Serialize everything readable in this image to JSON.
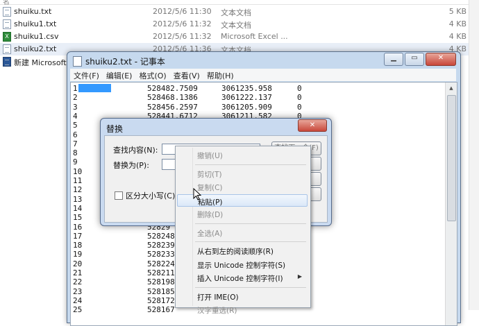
{
  "explorer": {
    "header_fragment": "名",
    "files": [
      {
        "name": "shuiku.txt",
        "date": "2012/5/6 11:30",
        "type": "文本文档",
        "size": "5 KB",
        "icon": "text-file-icon"
      },
      {
        "name": "shuiku1.txt",
        "date": "2012/5/6 11:32",
        "type": "文本文档",
        "size": "4 KB",
        "icon": "text-file-icon"
      },
      {
        "name": "shuiku1.csv",
        "date": "2012/5/6 11:32",
        "type": "Microsoft Excel ...",
        "size": "4 KB",
        "icon": "excel-file-icon"
      },
      {
        "name": "shuiku2.txt",
        "date": "2012/5/6 11:36",
        "type": "文本文档",
        "size": "4 KB",
        "icon": "text-file-icon",
        "selected": true
      },
      {
        "name": "新建 Microsoft Word",
        "date": "",
        "type": "",
        "size": "",
        "icon": "word-file-icon"
      }
    ]
  },
  "notepad": {
    "title": "shuiku2.txt - 记事本",
    "menu": [
      "文件(F)",
      "编辑(E)",
      "格式(O)",
      "查看(V)",
      "帮助(H)"
    ],
    "lines": [
      {
        "n": "1",
        "a": "528482.7509",
        "b": "3061235.958",
        "c": "0"
      },
      {
        "n": "2",
        "a": "528468.1386",
        "b": "3061222.137",
        "c": "0"
      },
      {
        "n": "3",
        "a": "528456.2597",
        "b": "3061205.909",
        "c": "0"
      },
      {
        "n": "4",
        "a": "528441.6712",
        "b": "3061211.582",
        "c": "0"
      },
      {
        "n": "5",
        "a": "",
        "b": "",
        "c": ""
      },
      {
        "n": "6",
        "a": "",
        "b": "",
        "c": ""
      },
      {
        "n": "7",
        "a": "",
        "b": "",
        "c": ""
      },
      {
        "n": "8",
        "a": "",
        "b": "",
        "c": ""
      },
      {
        "n": "9",
        "a": "",
        "b": "",
        "c": ""
      },
      {
        "n": "10",
        "a": "",
        "b": "",
        "c": ""
      },
      {
        "n": "11",
        "a": "",
        "b": "",
        "c": ""
      },
      {
        "n": "12",
        "a": "",
        "b": "",
        "c": ""
      },
      {
        "n": "13",
        "a": "",
        "b": "",
        "c": ""
      },
      {
        "n": "14",
        "a": "",
        "b": "",
        "c": ""
      },
      {
        "n": "15",
        "a": "",
        "b": "",
        "c": ""
      },
      {
        "n": "16",
        "a": "52829",
        "b": "",
        "c": ""
      },
      {
        "n": "17",
        "a": "528248.",
        "b": "",
        "c": ""
      },
      {
        "n": "18",
        "a": "528239.",
        "b": "",
        "c": ""
      },
      {
        "n": "19",
        "a": "528233.",
        "b": "",
        "c": ""
      },
      {
        "n": "20",
        "a": "528224.",
        "b": "",
        "c": ""
      },
      {
        "n": "21",
        "a": "528211.",
        "b": "",
        "c": ""
      },
      {
        "n": "22",
        "a": "528198.",
        "b": "",
        "c": ""
      },
      {
        "n": "23",
        "a": "528185.",
        "b": "",
        "c": ""
      },
      {
        "n": "24",
        "a": "528172.",
        "b": "",
        "c": ""
      },
      {
        "n": "25",
        "a": "528167",
        "b": "",
        "c": ""
      }
    ]
  },
  "replace_dialog": {
    "title": "替换",
    "find_label": "查找内容(N):",
    "replace_label": "替换为(P):",
    "find_next": "查找下一个(F)",
    "match_case": "区分大小写(C)"
  },
  "context_menu": {
    "items": [
      {
        "label": "撤销(U)",
        "disabled": true
      },
      {
        "sep": true
      },
      {
        "label": "剪切(T)",
        "disabled": true
      },
      {
        "label": "复制(C)",
        "disabled": true
      },
      {
        "label": "粘贴(P)",
        "disabled": false,
        "highlight": true
      },
      {
        "label": "删除(D)",
        "disabled": true
      },
      {
        "sep": true
      },
      {
        "label": "全选(A)",
        "disabled": true
      },
      {
        "sep": true
      },
      {
        "label": "从右到左的阅读顺序(R)",
        "disabled": false
      },
      {
        "label": "显示 Unicode 控制字符(S)",
        "disabled": false
      },
      {
        "label": "插入 Unicode 控制字符(I)",
        "disabled": false,
        "submenu": true
      },
      {
        "sep": true
      },
      {
        "label": "打开 IME(O)",
        "disabled": false
      },
      {
        "label": "汉字重选(R)",
        "disabled": true
      }
    ]
  },
  "colors": {
    "selection": "#3399ff",
    "window_frame": "#c6d9ee"
  }
}
